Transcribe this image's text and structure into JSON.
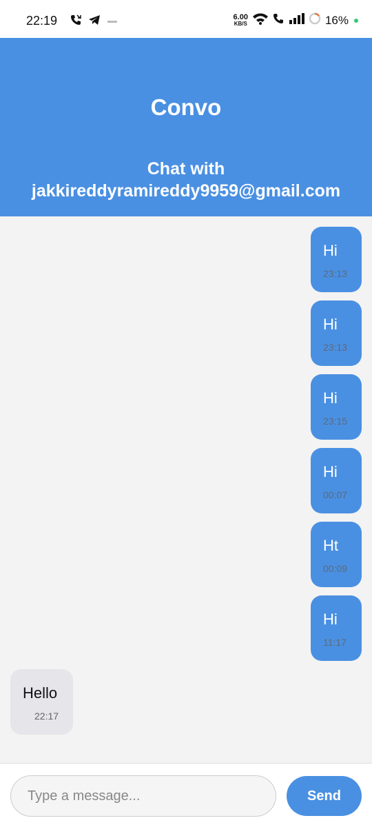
{
  "status_bar": {
    "time": "22:19",
    "net_speed_value": "6.00",
    "net_speed_unit": "KB/S",
    "battery": "16%",
    "icons": [
      "phone-call-icon",
      "telegram-icon",
      "notification-icon",
      "wifi-icon",
      "wifi-call-icon",
      "signal-icon",
      "battery-ring-icon",
      "active-dot-icon"
    ]
  },
  "header": {
    "title": "Convo",
    "subtitle_line1": "Chat with",
    "subtitle_line2": "jakkireddyramireddy9959@gmail.com"
  },
  "messages": [
    {
      "text": "Hi",
      "time": "23:13",
      "direction": "sent"
    },
    {
      "text": "Hi",
      "time": "23:13",
      "direction": "sent"
    },
    {
      "text": "Hi",
      "time": "23:15",
      "direction": "sent"
    },
    {
      "text": "Hi",
      "time": "00:07",
      "direction": "sent"
    },
    {
      "text": "Ht",
      "time": "00:09",
      "direction": "sent"
    },
    {
      "text": "Hi",
      "time": "11:17",
      "direction": "sent"
    },
    {
      "text": "Hello",
      "time": "22:17",
      "direction": "received"
    }
  ],
  "composer": {
    "placeholder": "Type a message...",
    "value": "",
    "send_label": "Send"
  },
  "colors": {
    "accent": "#4a90e2",
    "received_bubble": "#e5e5ea",
    "background": "#f3f3f3"
  }
}
